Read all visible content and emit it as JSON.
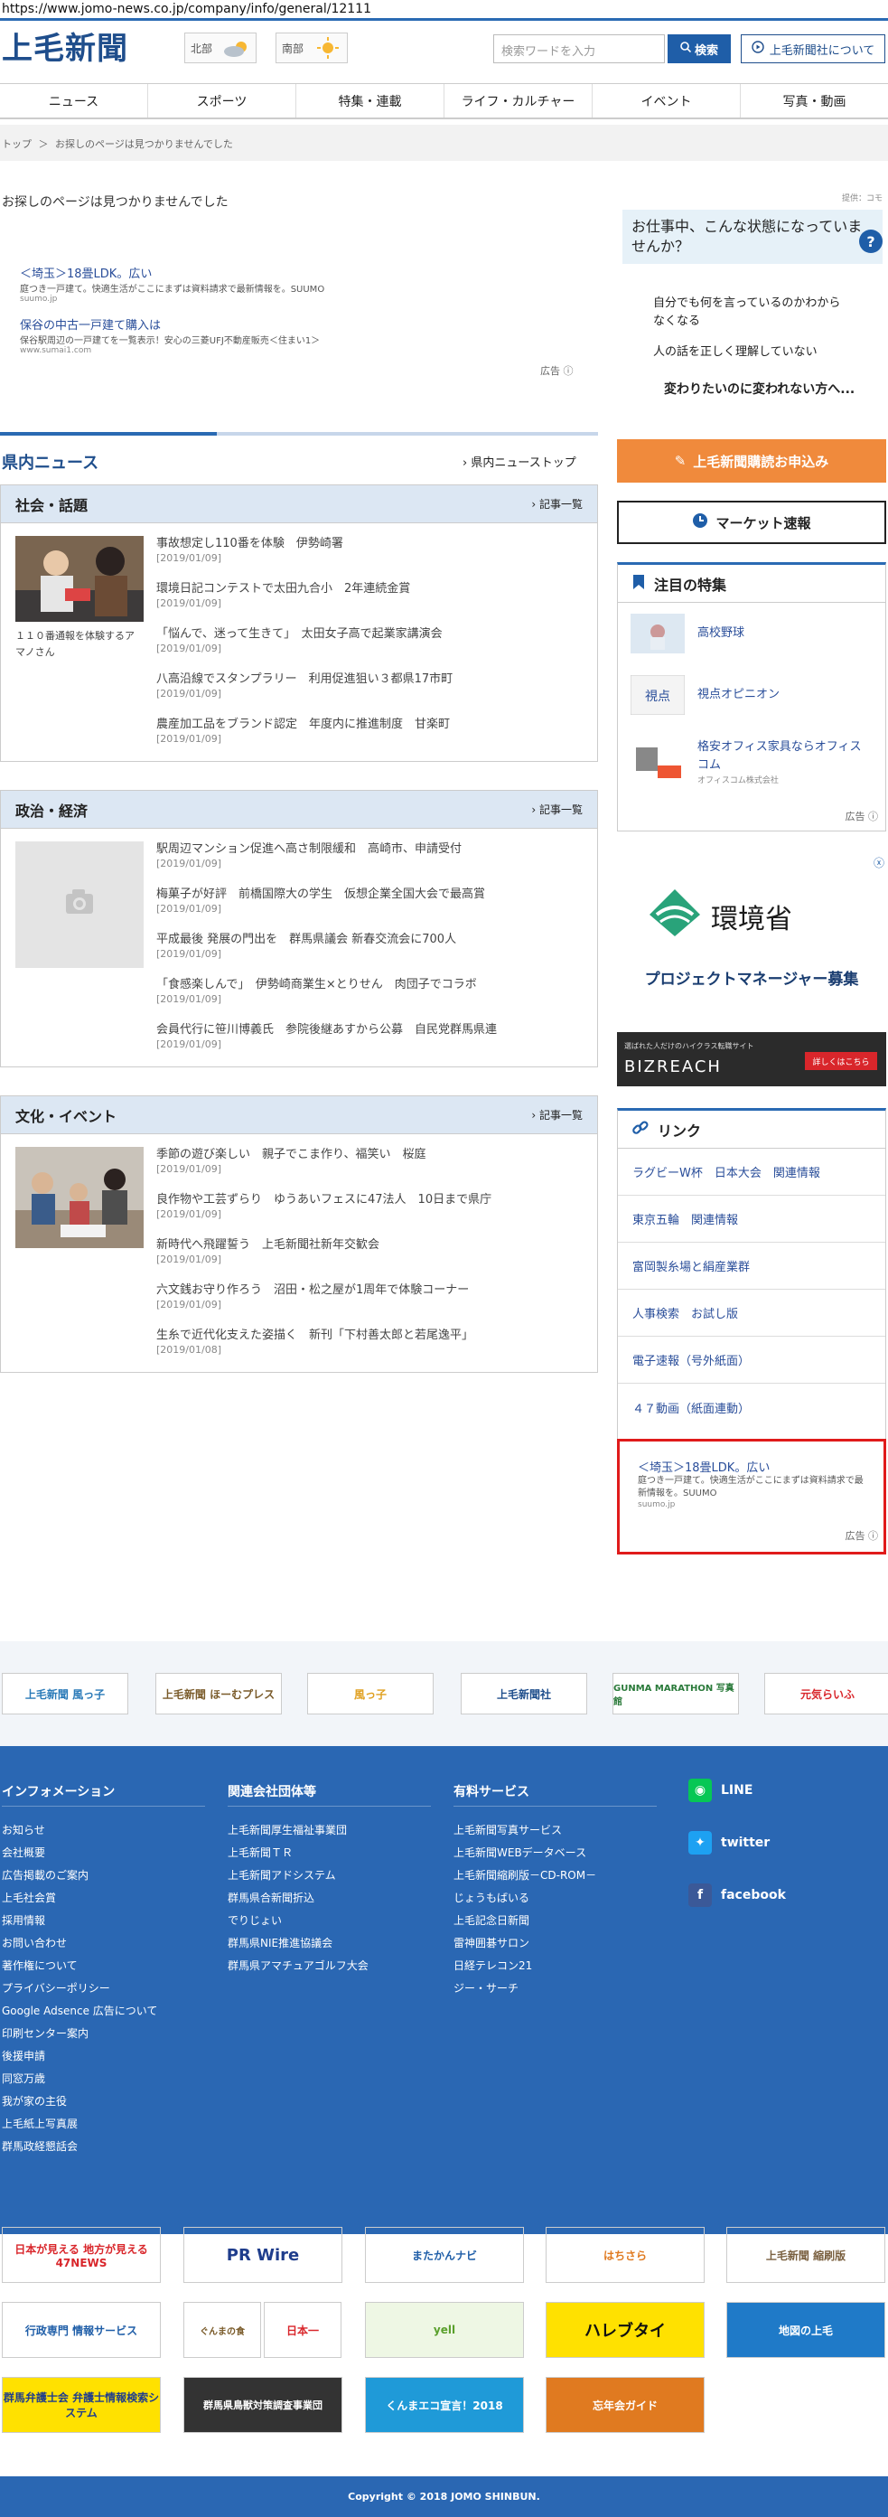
{
  "browser": {
    "url": "https://www.jomo-news.co.jp/company/info/general/12111"
  },
  "header": {
    "logo": "上毛新聞",
    "weather": [
      {
        "region": "北部"
      },
      {
        "region": "南部"
      }
    ],
    "search_placeholder": "検索ワードを入力",
    "search_button": "検索",
    "corp_button": "上毛新聞社について"
  },
  "nav": [
    "ニュース",
    "スポーツ",
    "特集・連載",
    "ライフ・カルチャー",
    "イベント",
    "写真・動画"
  ],
  "breadcrumb": {
    "home": "トップ",
    "sep": "＞",
    "current": "お探しのページは見つかりませんでした"
  },
  "main": {
    "not_found": "お探しのページは見つかりませんでした"
  },
  "top_ad": {
    "items": [
      {
        "title": "＜埼玉＞18畳LDK。広い",
        "sub": "庭つき一戸建て。快適生活がここにまずは資料請求で最新情報を。SUUMO",
        "src": "suumo.jp"
      },
      {
        "title": "保谷の中古一戸建て購入は",
        "sub": "保谷駅周辺の一戸建てを一覧表示！安心の三菱UFJ不動産販売＜住まい1＞",
        "src": "www.sumai1.com"
      }
    ],
    "label": "広告"
  },
  "news": {
    "title": "県内ニュース",
    "top_link": "県内ニューストップ",
    "sections": [
      {
        "title": "社会・話題",
        "more": "記事一覧",
        "caption": "１１０番通報を体験するアマノさん",
        "items": [
          {
            "title": "事故想定し110番を体験　伊勢崎署",
            "date": "[2019/01/09]"
          },
          {
            "title": "環境日記コンテストで太田九合小　2年連続金賞",
            "date": "[2019/01/09]"
          },
          {
            "title": "「悩んで、迷って生きて」　太田女子高で起業家講演会",
            "date": "[2019/01/09]"
          },
          {
            "title": "八高沿線でスタンプラリー　利用促進狙い３都県17市町",
            "date": "[2019/01/09]"
          },
          {
            "title": "農産加工品をブランド認定　年度内に推進制度　甘楽町",
            "date": "[2019/01/09]"
          }
        ]
      },
      {
        "title": "政治・経済",
        "more": "記事一覧",
        "caption": "",
        "items": [
          {
            "title": "駅周辺マンション促進へ高さ制限緩和　高崎市、申請受付",
            "date": "[2019/01/09]"
          },
          {
            "title": "梅菓子が好評　前橋国際大の学生　仮想企業全国大会で最高賞",
            "date": "[2019/01/09]"
          },
          {
            "title": "平成最後 発展の門出を　群馬県議会 新春交流会に700人",
            "date": "[2019/01/09]"
          },
          {
            "title": "「食感楽しんで」　伊勢崎商業生×とりせん　肉団子でコラボ",
            "date": "[2019/01/09]"
          },
          {
            "title": "会員代行に笹川博義氏　参院後継あすから公募　自民党群馬県連",
            "date": "[2019/01/09]"
          }
        ]
      },
      {
        "title": "文化・イベント",
        "more": "記事一覧",
        "caption": "",
        "items": [
          {
            "title": "季節の遊び楽しい　親子でこま作り、福笑い　桜庭",
            "date": "[2019/01/09]"
          },
          {
            "title": "良作物や工芸ずらり　ゆうあいフェスに47法人　10日まで県庁",
            "date": "[2019/01/09]"
          },
          {
            "title": "新時代へ飛躍誓う　上毛新聞社新年交歓会",
            "date": "[2019/01/09]"
          },
          {
            "title": "六文銭お守り作ろう　沼田・松之屋が1周年で体験コーナー",
            "date": "[2019/01/09]"
          },
          {
            "title": "生糸で近代化支えた姿描く　新刊「下村善太郎と若尾逸平」",
            "date": "[2019/01/08]"
          }
        ]
      }
    ]
  },
  "side_ad": {
    "tag": "提供：コモ",
    "head": "お仕事中、こんな状態になっていませんか？",
    "lines": [
      "自分でも何を言っているのかわからなくなる",
      "人の話を正しく理解していない"
    ],
    "tagline": "変わりたいのに変われない方へ..."
  },
  "side_buttons": {
    "subscribe": "上毛新聞購読お申込み",
    "market": "マーケット速報"
  },
  "tokushu": {
    "title": "注目の特集",
    "items": [
      {
        "label": "高校野球",
        "sub": ""
      },
      {
        "label": "視点オピニオン",
        "sub": ""
      },
      {
        "label": "格安オフィス家具ならオフィスコム",
        "sub": "オフィスコム株式会社"
      }
    ],
    "ad_label": "広告"
  },
  "env_ad": {
    "org": "環境省",
    "role": "プロジェクトマネージャー募集",
    "banner_small": "選ばれた人だけのハイクラス転職サイト",
    "banner_name": "BIZREACH",
    "banner_cta": "詳しくはこちら"
  },
  "links": {
    "title": "リンク",
    "items": [
      "ラグビーW杯　日本大会　関連情報",
      "東京五輪　関連情報",
      "富岡製糸場と絹産業群",
      "人事検索　お試し版",
      "電子速報（号外紙面）",
      "４７動画（紙面連動）"
    ]
  },
  "side_bottom_ad": {
    "title": "＜埼玉＞18畳LDK。広い",
    "sub": "庭つき一戸建て。快適生活がここにまずは資料請求で最新情報を。SUUMO",
    "src": "suumo.jp",
    "label": "広告"
  },
  "banners": [
    "上毛新聞 風っ子",
    "上毛新聞 ほーむプレス",
    "風っ子",
    "上毛新聞社",
    "GUNMA MARATHON 写真館",
    "元気らいふ"
  ],
  "footer": {
    "cols": [
      {
        "title": "インフォメーション",
        "links": [
          "お知らせ",
          "会社概要",
          "広告掲載のご案内",
          "上毛社会賞",
          "採用情報",
          "お問い合わせ",
          "著作権について",
          "プライバシーポリシー",
          "Google Adsence 広告について",
          "印刷センター案内",
          "後援申請",
          "同窓万歳",
          "我が家の主役",
          "上毛紙上写真展",
          "群馬政経懇話会"
        ]
      },
      {
        "title": "関連会社団体等",
        "links": [
          "上毛新聞厚生福祉事業団",
          "上毛新聞ＴＲ",
          "上毛新聞アドシステム",
          "群馬県合新聞折込",
          "でりじょい",
          "群馬県NIE推進協議会",
          "群馬県アマチュアゴルフ大会"
        ]
      },
      {
        "title": "有料サービス",
        "links": [
          "上毛新聞写真サービス",
          "上毛新聞WEBデータベース",
          "上毛新聞縮刷版－CD-ROM－",
          "じょうもばいる",
          "上毛記念日新聞",
          "雷神囲碁サロン",
          "日経テレコン21",
          "ジー・サーチ"
        ]
      }
    ],
    "social": [
      "LINE",
      "twitter",
      "facebook"
    ]
  },
  "ad_grid": [
    "日本が見える 地方が見える 47NEWS",
    "PR Wire",
    "またかんナビ",
    "はちさら",
    "上毛新聞 縮刷版",
    "行政専門 情報サービス",
    "ぐんまの食",
    "日本一",
    "yell",
    "ハレブタイ",
    "地図の上毛",
    "群馬弁護士会 弁護士情報検索システム",
    "群馬県鳥獣対策調査事業団",
    "くんまエコ宣言！2018",
    "忘年会ガイド"
  ],
  "copyright": "Copyright © 2018 JOMO SHINBUN."
}
